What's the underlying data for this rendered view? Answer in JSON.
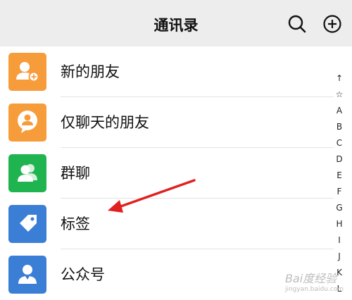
{
  "header": {
    "title": "通讯录",
    "search_icon": "search-icon",
    "add_icon": "plus-circle-icon"
  },
  "rows": [
    {
      "label": "新的朋友",
      "icon": "add-friend-icon",
      "color": "#f79c3a"
    },
    {
      "label": "仅聊天的朋友",
      "icon": "chat-only-friend-icon",
      "color": "#f79c3a"
    },
    {
      "label": "群聊",
      "icon": "group-chat-icon",
      "color": "#1fb450"
    },
    {
      "label": "标签",
      "icon": "tag-icon",
      "color": "#3b7ed6"
    },
    {
      "label": "公众号",
      "icon": "official-account-icon",
      "color": "#3b7ed6"
    }
  ],
  "index_letters": [
    "↑",
    "☆",
    "A",
    "B",
    "C",
    "D",
    "E",
    "F",
    "G",
    "H",
    "I",
    "J",
    "K",
    "L"
  ],
  "annotation": {
    "arrow_color": "#e02020"
  },
  "watermark": {
    "text": "Bai度经验",
    "sub": "jingyan.baidu.com"
  }
}
